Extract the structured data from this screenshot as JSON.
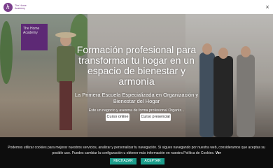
{
  "header": {
    "logo_initial": "h",
    "logo_text": "The Home Academy",
    "close_label": "×"
  },
  "hero": {
    "sign_text": "The Home Academy",
    "title": "Formación profesional para transformar tu hogar en un espacio de bienestar y armonía",
    "subtitle": "La Primera Escuela Especializada en Organización y Bienestar del Hogar",
    "small_text": "Este un negocio y asesora de forma profesional Organiz...",
    "buttons": [
      {
        "label": "Curso online"
      },
      {
        "label": "Curso presencial"
      }
    ]
  },
  "cookie": {
    "text": "Podemos utilizar cookies para mejorar nuestros servicios, analizar y personalizar tu navegación. Si sigues navegando por nuestra web, consideramos que aceptas su posible uso. Puedes cambiar la configuración u obtener más información en nuestra Política de Cookies.",
    "more_link": "Ver",
    "reject_label": "RECHAZAR",
    "accept_label": "ACEPTAR",
    "button_color": "#1c9e8c"
  },
  "colors": {
    "brand": "#7b3f8c",
    "cookie_bg": "#0d0d0d"
  }
}
